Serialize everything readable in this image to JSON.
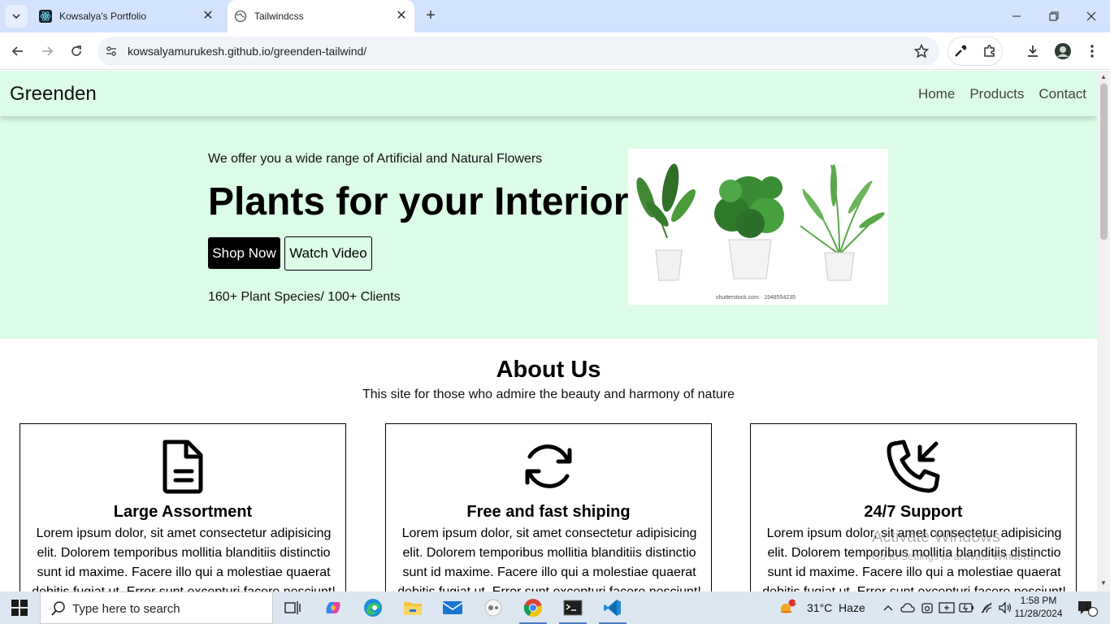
{
  "browser": {
    "tabs": [
      {
        "title": "Kowsalya's Portfolio",
        "active": false
      },
      {
        "title": "Tailwindcss",
        "active": true
      }
    ],
    "url": "kowsalyamurukesh.github.io/greenden-tailwind/"
  },
  "site": {
    "brand": "Greenden",
    "nav": [
      "Home",
      "Products",
      "Contact"
    ],
    "hero": {
      "kicker": "We offer you a wide range of Artificial and Natural Flowers",
      "headline": "Plants for your Interior",
      "primary_button": "Shop Now",
      "secondary_button": "Watch Video",
      "stats": "160+ Plant Species/ 100+ Clients",
      "image_credit": "shutterstock.com · 1948554235"
    },
    "about": {
      "title": "About Us",
      "subtitle": "This site for those who admire the beauty and harmony of nature",
      "cards": [
        {
          "icon": "document-icon",
          "title": "Large Assortment",
          "text": "Lorem ipsum dolor, sit amet consectetur adipisicing elit. Dolorem temporibus mollitia blanditiis distinctio sunt id maxime. Facere illo qui a molestiae quaerat debitis fugiat ut. Error sunt excepturi facere nesciunt!"
        },
        {
          "icon": "refresh-icon",
          "title": "Free and fast shiping",
          "text": "Lorem ipsum dolor, sit amet consectetur adipisicing elit. Dolorem temporibus mollitia blanditiis distinctio sunt id maxime. Facere illo qui a molestiae quaerat debitis fugiat ut. Error sunt excepturi facere nesciunt!"
        },
        {
          "icon": "phone-incoming-icon",
          "title": "24/7 Support",
          "text": "Lorem ipsum dolor, sit amet consectetur adipisicing elit. Dolorem temporibus mollitia blanditiis distinctio sunt id maxime. Facere illo qui a molestiae quaerat debitis fugiat ut. Error sunt excepturi facere nesciunt!"
        }
      ]
    }
  },
  "watermark": {
    "line1": "Activate Windows",
    "line2": "Go to Settings to activate Windows."
  },
  "taskbar": {
    "search_placeholder": "Type here to search",
    "weather": "31°C  Haze",
    "weather_badge": "1",
    "time": "1:58 PM",
    "date": "11/28/2024",
    "notif_count": "1"
  },
  "colors": {
    "hero_bg": "#dcfce7",
    "tab_bar": "#d3e3fd",
    "taskbar": "#dde7f1"
  }
}
